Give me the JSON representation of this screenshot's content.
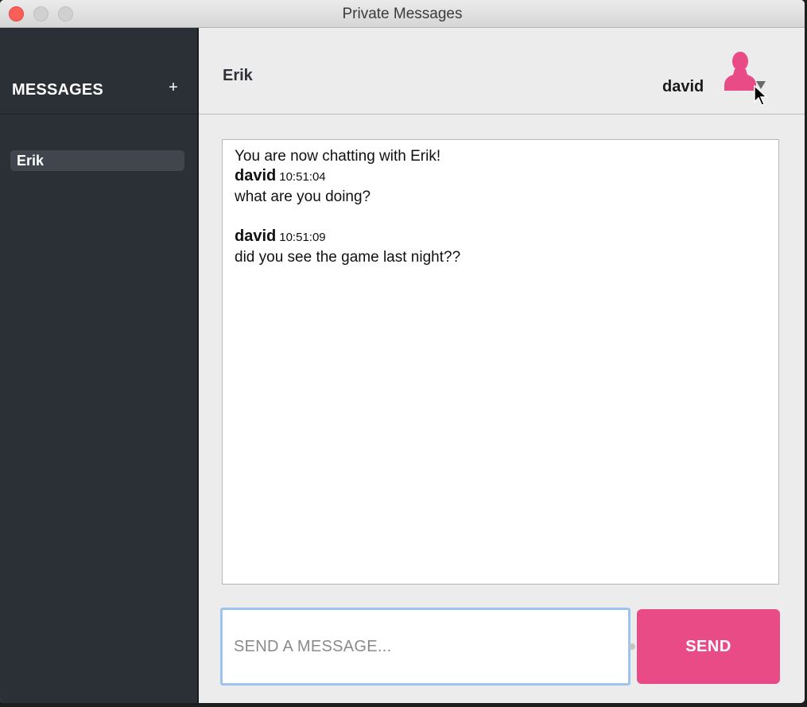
{
  "window": {
    "title": "Private Messages"
  },
  "sidebar": {
    "title": "MESSAGES",
    "add_label": "+",
    "conversations": [
      {
        "label": "Erik",
        "selected": true
      }
    ]
  },
  "header": {
    "contact_name": "Erik",
    "current_user": "david",
    "avatar_icon": "user-silhouette-icon",
    "dropdown_icon": "triangle-down-icon"
  },
  "chat": {
    "system_message": "You are now chatting with Erik!",
    "messages": [
      {
        "author": "david",
        "time": "10:51:04",
        "text": "what are you doing?"
      },
      {
        "author": "david",
        "time": "10:51:09",
        "text": "did you see the game last night??"
      }
    ]
  },
  "composer": {
    "placeholder": "SEND A MESSAGE...",
    "value": "",
    "send_label": "SEND"
  },
  "colors": {
    "accent": "#e94b87",
    "sidebar_bg": "#2b3037",
    "input_focus": "#9ec3f0"
  }
}
